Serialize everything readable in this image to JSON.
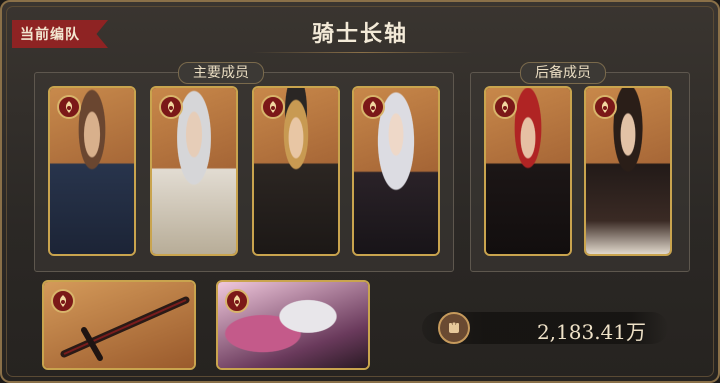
{
  "header": {
    "ribbon_label": "当前编队",
    "title": "骑士长轴"
  },
  "main_team": {
    "label": "主要成员",
    "members": [
      {
        "icon": "faction-emblem-icon",
        "portrait": "knight-brown-hair-portrait"
      },
      {
        "icon": "faction-emblem-icon",
        "portrait": "knight-silver-hair-portrait"
      },
      {
        "icon": "faction-emblem-icon",
        "portrait": "knight-blonde-cap-portrait"
      },
      {
        "icon": "faction-emblem-icon",
        "portrait": "knight-white-hair-portrait"
      }
    ]
  },
  "reserve_team": {
    "label": "后备成员",
    "members": [
      {
        "icon": "faction-emblem-icon",
        "portrait": "knight-red-hair-portrait"
      },
      {
        "icon": "faction-emblem-icon",
        "portrait": "knight-dark-hair-portrait"
      }
    ]
  },
  "equipment": {
    "weapon": {
      "icon": "faction-emblem-icon",
      "art": "greatsword-art"
    },
    "companion": {
      "icon": "faction-emblem-icon",
      "art": "silver-hair-card-art"
    }
  },
  "power": {
    "icon": "fist-icon",
    "value": "2,183.41万"
  },
  "colors": {
    "ribbon": "#8e2323",
    "card_border": "#c9a44e",
    "badge": "#7b1818"
  }
}
